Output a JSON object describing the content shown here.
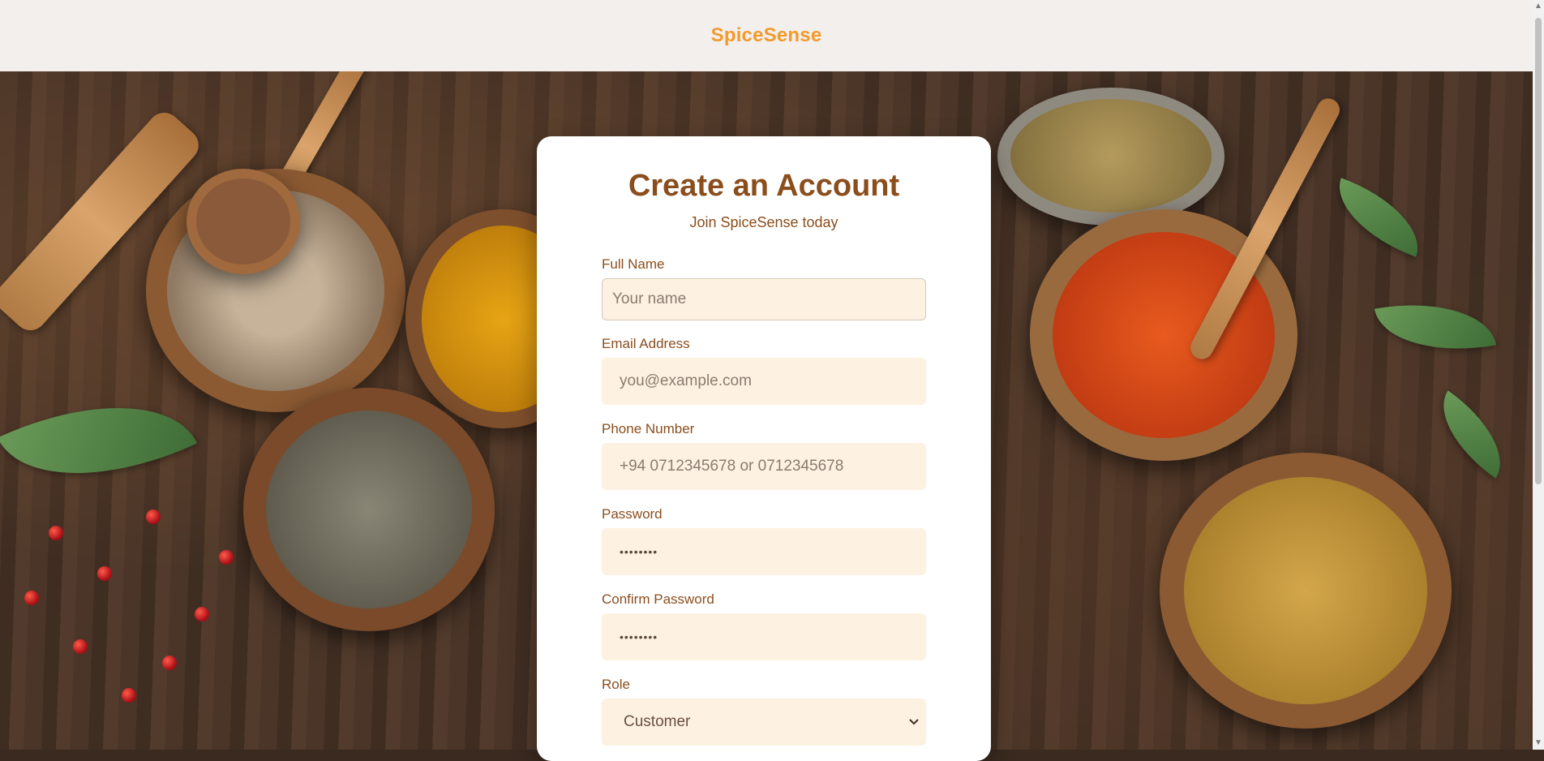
{
  "header": {
    "brand": "SpiceSense"
  },
  "form": {
    "title": "Create an Account",
    "subtitle": "Join SpiceSense today",
    "fields": [
      {
        "label": "Full Name",
        "placeholder": "Your name"
      },
      {
        "label": "Email Address",
        "placeholder": "you@example.com"
      },
      {
        "label": "Phone Number",
        "placeholder": "+94 0712345678 or 0712345678"
      },
      {
        "label": "Password",
        "placeholder": "••••••••"
      },
      {
        "label": "Confirm Password",
        "placeholder": "••••••••"
      },
      {
        "label": "Role",
        "value": "Customer"
      }
    ]
  },
  "icons": {
    "select": "chevron-down-icon",
    "scroll_up": "arrow-up-icon",
    "scroll_down": "arrow-down-icon"
  },
  "colors": {
    "brand": "#f39a2b",
    "heading": "#8a4e1d",
    "input_bg": "#fdf1e2"
  }
}
